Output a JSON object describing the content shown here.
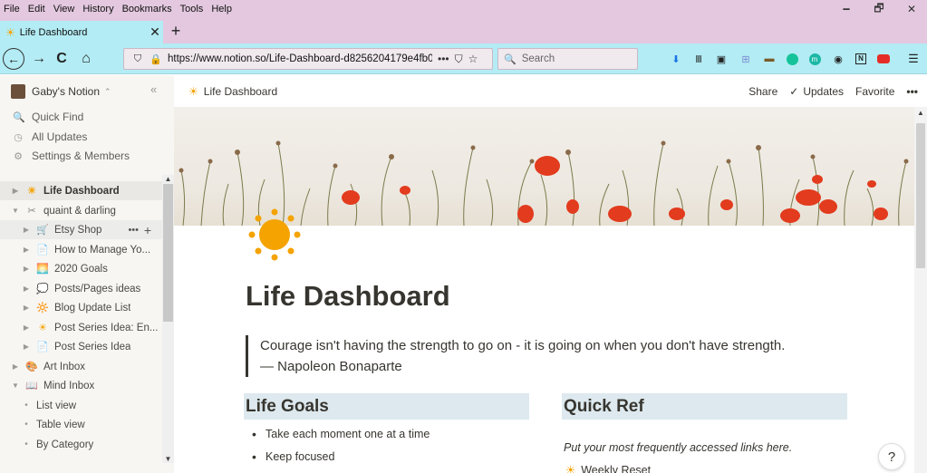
{
  "menu": [
    "File",
    "Edit",
    "View",
    "History",
    "Bookmarks",
    "Tools",
    "Help"
  ],
  "window_controls": {
    "minimize": "🗕",
    "restore": "🗗",
    "close": "✕"
  },
  "tab": {
    "title": "Life Dashboard",
    "close": "✕",
    "new_tab": "+"
  },
  "nav": {
    "back": "←",
    "forward": "→",
    "reload": "C",
    "home": "⌂",
    "url": "https://www.notion.so/Life-Dashboard-d8256204179e4fb0",
    "page_actions": "•••",
    "search_placeholder": "Search"
  },
  "toolbar_icons": [
    "download-icon",
    "library-icon",
    "reader-icon",
    "grid-icon",
    "extension-icon",
    "grammarly-icon",
    "m-icon",
    "account-icon",
    "notion-icon",
    "youtube-icon",
    "menu-icon"
  ],
  "sidebar": {
    "workspace": "Gaby's Notion",
    "workspace_chevron": "⌃",
    "collapse": "«",
    "actions": [
      {
        "icon": "search-icon",
        "glyph": "🔍",
        "label": "Quick Find"
      },
      {
        "icon": "clock-icon",
        "glyph": "◷",
        "label": "All Updates"
      },
      {
        "icon": "gear-icon",
        "glyph": "⚙",
        "label": "Settings & Members"
      }
    ],
    "pages": [
      {
        "label": "Life Dashboard",
        "emoji": "☀",
        "level": 0,
        "toggle": "▶",
        "active": true
      },
      {
        "label": "quaint & darling",
        "emoji": "✂",
        "level": 0,
        "toggle": "▼"
      },
      {
        "label": "Etsy Shop",
        "emoji": "🛒",
        "level": 1,
        "toggle": "▶",
        "hover": true,
        "more": "•••",
        "plus": "+"
      },
      {
        "label": "How to Manage Yo...",
        "emoji": "📄",
        "level": 1,
        "toggle": "▶"
      },
      {
        "label": "2020 Goals",
        "emoji": "🌅",
        "level": 1,
        "toggle": "▶"
      },
      {
        "label": "Posts/Pages ideas",
        "emoji": "💭",
        "level": 1,
        "toggle": "▶"
      },
      {
        "label": "Blog Update List",
        "emoji": "🔆",
        "level": 1,
        "toggle": "▶"
      },
      {
        "label": "Post Series Idea: En...",
        "emoji": "☀",
        "level": 1,
        "toggle": "▶"
      },
      {
        "label": "Post Series Idea",
        "emoji": "📄",
        "level": 1,
        "toggle": "▶"
      },
      {
        "label": "Art Inbox",
        "emoji": "🎨",
        "level": 0,
        "toggle": "▶"
      },
      {
        "label": "Mind Inbox",
        "emoji": "📖",
        "level": 0,
        "toggle": "▼"
      },
      {
        "label": "List view",
        "level": 1,
        "bullet": "•"
      },
      {
        "label": "Table view",
        "level": 1,
        "bullet": "•"
      },
      {
        "label": "By Category",
        "level": 1,
        "bullet": "•"
      }
    ]
  },
  "topbar": {
    "breadcrumb": "Life Dashboard",
    "share": "Share",
    "updates": "Updates",
    "updates_check": "✓",
    "favorite": "Favorite",
    "more": "•••"
  },
  "page": {
    "title": "Life Dashboard",
    "quote_line1": "Courage isn't having the strength to go on - it is going on when you don't have strength.",
    "quote_line2": "— Napoleon Bonaparte",
    "life_goals": {
      "heading": "Life Goals",
      "items": [
        "Take each moment one at a time",
        "Keep focused"
      ]
    },
    "quick_ref": {
      "heading": "Quick Ref",
      "note": "Put your most frequently accessed links here.",
      "link": "Weekly Reset"
    }
  },
  "help": "?",
  "colors": {
    "tab_bar": "#e3c8df",
    "nav_bar": "#b3ecf4",
    "sidebar_bg": "#f7f6f3",
    "heading_bg": "#dde9ee",
    "sun": "#f4a300",
    "poppy": "#e23b1e"
  }
}
